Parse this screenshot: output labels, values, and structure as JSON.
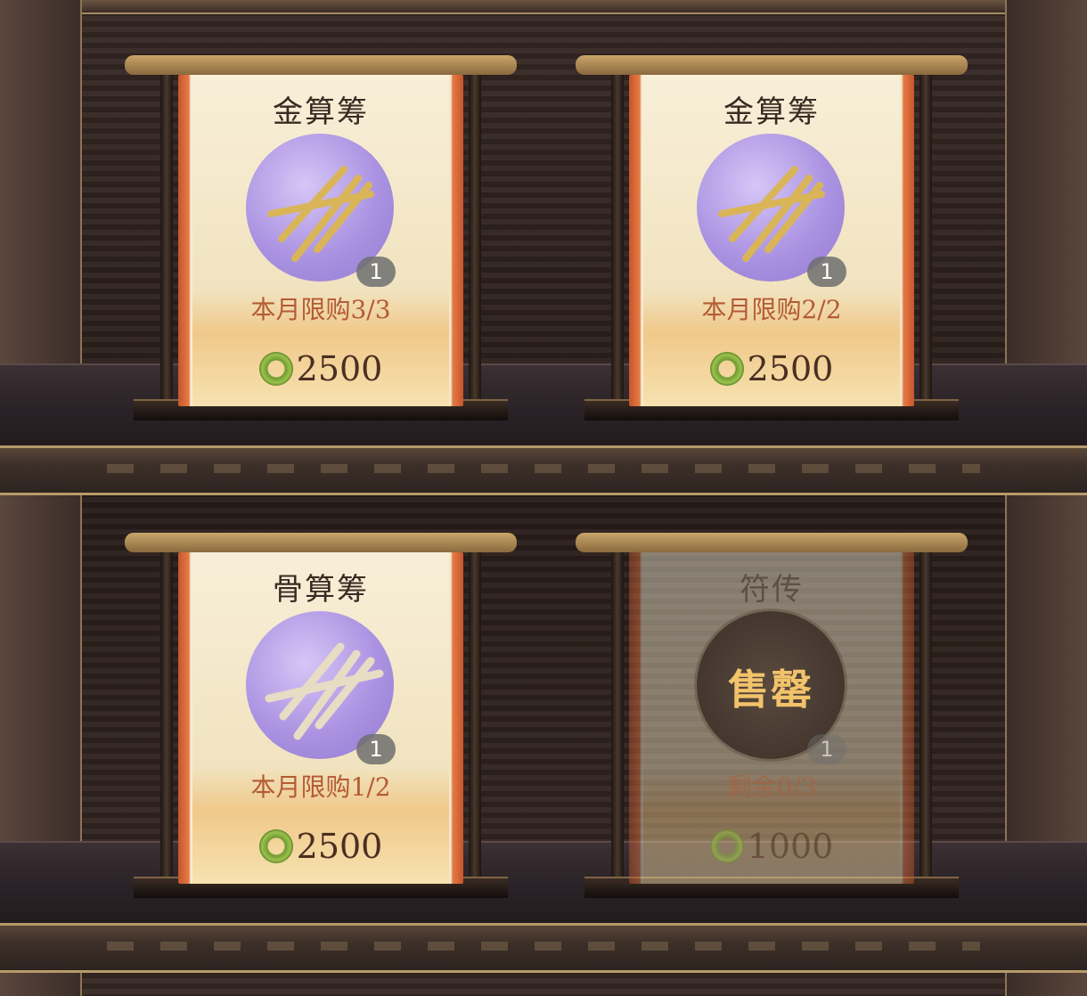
{
  "shop": {
    "items": [
      {
        "name": "金算筹",
        "quantity": "1",
        "limit": "本月限购3/3",
        "price": "2500",
        "sold_out": false,
        "icon": "gold-counting-rods-icon"
      },
      {
        "name": "金算筹",
        "quantity": "1",
        "limit": "本月限购2/2",
        "price": "2500",
        "sold_out": false,
        "icon": "gold-counting-rods-icon"
      },
      {
        "name": "骨算筹",
        "quantity": "1",
        "limit": "本月限购1/2",
        "price": "2500",
        "sold_out": false,
        "icon": "bone-counting-rods-icon"
      },
      {
        "name": "符传",
        "quantity": "1",
        "limit": "剩余0/3",
        "price": "1000",
        "sold_out": true,
        "sold_out_label": "售罄",
        "icon": "talisman-icon"
      }
    ],
    "currency_icon": "jade-coin-icon",
    "colors": {
      "scroll_border": "#c6552c",
      "limit_text": "#b35b34",
      "icon_circle": "#ab93e2",
      "sold_out_text": "#f2c36b"
    }
  }
}
